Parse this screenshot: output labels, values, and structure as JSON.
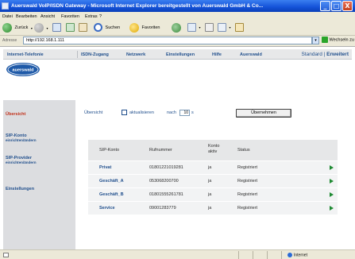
{
  "window": {
    "title": "Auerswald VoIP/ISDN Gateway - Microsoft Internet Explorer bereitgestellt von Auerswald GmbH & Co...",
    "minimize": "_",
    "maximize": "□",
    "close": "X"
  },
  "menu": [
    "Datei",
    "Bearbeiten",
    "Ansicht",
    "Favoriten",
    "Extras",
    "?"
  ],
  "toolbar": {
    "back": "Zurück",
    "search": "Suchen",
    "favorites": "Favoriten"
  },
  "address": {
    "label": "Adresse",
    "url": "http://192.168.1.111",
    "go": "Wechseln zu"
  },
  "nav": {
    "items": [
      "Internet-Telefonie",
      "ISDN-Zugang",
      "Netzwerk",
      "Einstellungen",
      "Hilfe",
      "Auerswald"
    ],
    "right_standard": "Standard",
    "right_sep": "|",
    "right_extended": "Erweitert"
  },
  "logo": {
    "text": "auerswald"
  },
  "sidebar": {
    "items": [
      {
        "label": "Übersicht",
        "sub": ""
      },
      {
        "label": "SIP-Konto",
        "sub": "einrichten/ändern"
      },
      {
        "label": "SIP-Provider",
        "sub": "einrichten/ändern"
      },
      {
        "label": "Einstellungen",
        "sub": ""
      }
    ]
  },
  "options": {
    "prefix": "Übersicht",
    "checkbox_label": "aktualisieren",
    "after": "nach",
    "value": "10",
    "unit": "s",
    "apply": "Übernehmen"
  },
  "table": {
    "headers": [
      "SIP-Konto",
      "Rufnummer",
      "Konto aktiv",
      "Status"
    ],
    "rows": [
      {
        "account": "Privat",
        "number": "01801221019281",
        "active": "ja",
        "status": "Registriert"
      },
      {
        "account": "Geschäft_A",
        "number": "053068200700",
        "active": "ja",
        "status": "Registriert"
      },
      {
        "account": "Geschäft_B",
        "number": "01801555261781",
        "active": "ja",
        "status": "Registriert"
      },
      {
        "account": "Service",
        "number": "09001283779",
        "active": "ja",
        "status": "Registriert"
      }
    ]
  },
  "status": {
    "zone": "Internet"
  }
}
